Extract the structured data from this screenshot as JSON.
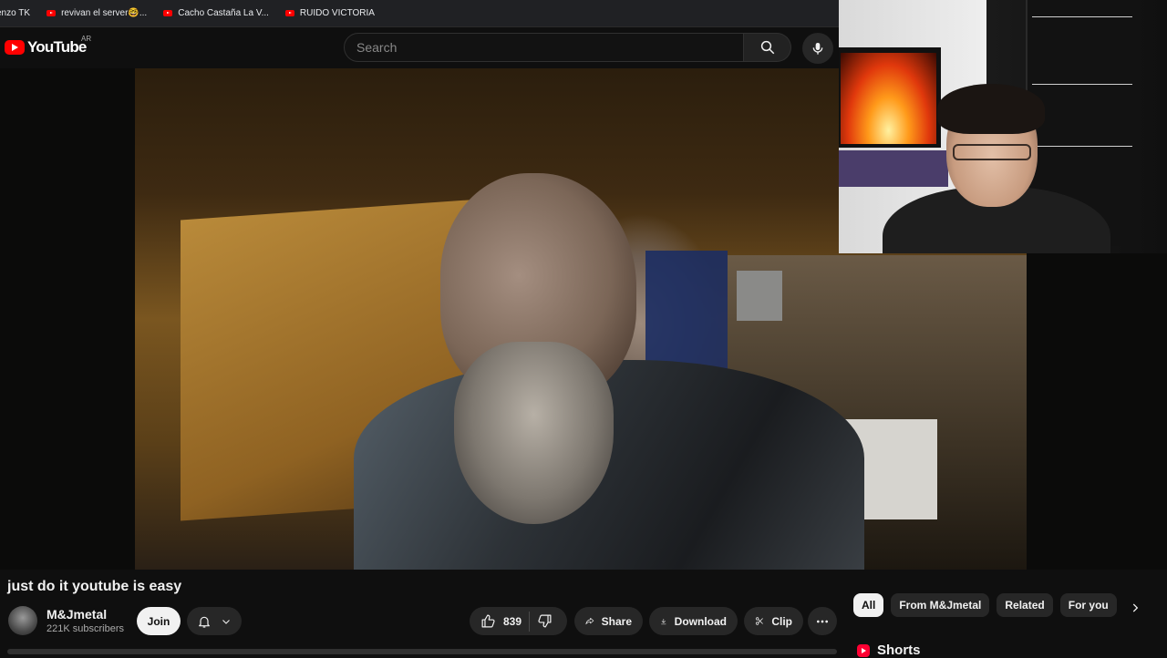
{
  "bookmarks": [
    {
      "label": "enzo TK"
    },
    {
      "label": "revivan el server🤓..."
    },
    {
      "label": "Cacho Castaña La V..."
    },
    {
      "label": "RUIDO VICTORIA"
    }
  ],
  "header": {
    "logo_text": "YouTube",
    "country_code": "AR",
    "search_placeholder": "Search"
  },
  "video": {
    "title": "just do it youtube is easy"
  },
  "channel": {
    "name": "M&Jmetal",
    "subscribers": "221K subscribers",
    "join_label": "Join"
  },
  "actions": {
    "like_count": "839",
    "share_label": "Share",
    "download_label": "Download",
    "clip_label": "Clip"
  },
  "chips": [
    {
      "label": "All",
      "active": true
    },
    {
      "label": "From M&Jmetal",
      "active": false
    },
    {
      "label": "Related",
      "active": false
    },
    {
      "label": "For you",
      "active": false
    }
  ],
  "shorts": {
    "label": "Shorts"
  },
  "colors": {
    "background": "#0f0f0f",
    "brand_red": "#ff0000",
    "pill": "#272727",
    "text": "#f1f1f1"
  }
}
